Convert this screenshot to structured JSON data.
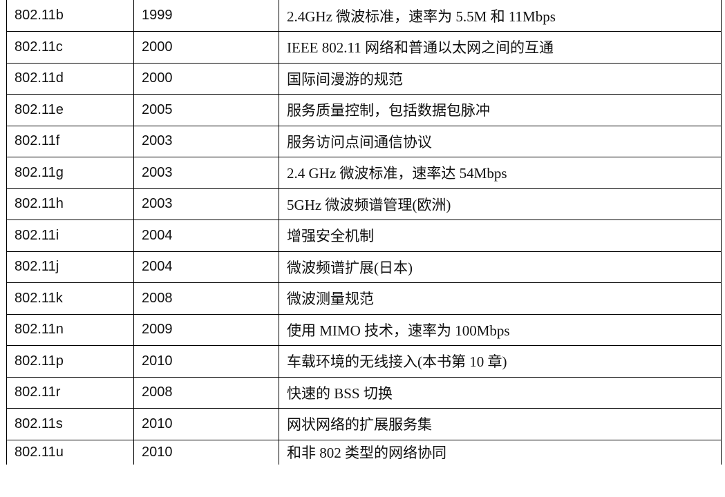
{
  "table": {
    "rows": [
      {
        "std": "802.11b",
        "year": "1999",
        "desc": "2.4GHz 微波标准，速率为 5.5M 和 11Mbps"
      },
      {
        "std": "802.11c",
        "year": "2000",
        "desc": "IEEE 802.11 网络和普通以太网之间的互通"
      },
      {
        "std": "802.11d",
        "year": "2000",
        "desc": "国际间漫游的规范"
      },
      {
        "std": "802.11e",
        "year": "2005",
        "desc": "服务质量控制，包括数据包脉冲"
      },
      {
        "std": "802.11f",
        "year": "2003",
        "desc": "服务访问点间通信协议"
      },
      {
        "std": "802.11g",
        "year": "2003",
        "desc": "2.4 GHz 微波标准，速率达 54Mbps"
      },
      {
        "std": "802.11h",
        "year": "2003",
        "desc": "5GHz 微波频谱管理(欧洲)"
      },
      {
        "std": "802.11i",
        "year": "2004",
        "desc": "增强安全机制"
      },
      {
        "std": "802.11j",
        "year": "2004",
        "desc": "微波频谱扩展(日本)"
      },
      {
        "std": "802.11k",
        "year": "2008",
        "desc": "微波测量规范"
      },
      {
        "std": "802.11n",
        "year": "2009",
        "desc": "使用 MIMO 技术，速率为 100Mbps"
      },
      {
        "std": "802.11p",
        "year": "2010",
        "desc": "车载环境的无线接入(本书第 10 章)"
      },
      {
        "std": "802.11r",
        "year": "2008",
        "desc": "快速的 BSS 切换"
      },
      {
        "std": "802.11s",
        "year": "2010",
        "desc": "网状网络的扩展服务集"
      },
      {
        "std": "802.11u",
        "year": "2010",
        "desc": "和非 802 类型的网络协同"
      }
    ]
  }
}
